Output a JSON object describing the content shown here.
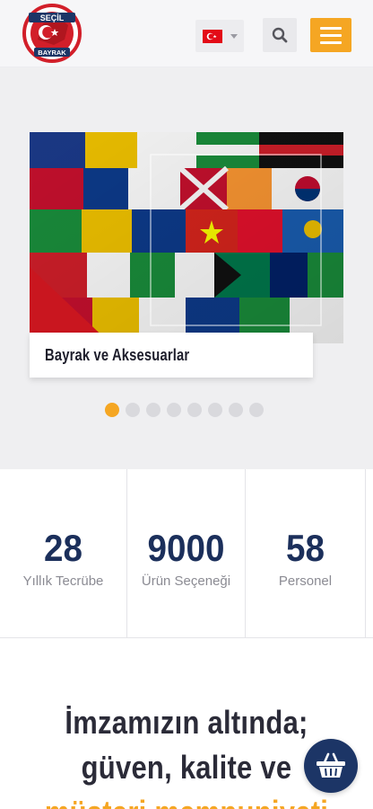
{
  "header": {
    "logo_text_top": "SEÇİL",
    "logo_text_bottom": "BAYRAK",
    "language": "tr",
    "icons": [
      "turkey-flag-icon",
      "caret-down-icon",
      "search-icon",
      "hamburger-menu-icon"
    ]
  },
  "slider": {
    "image": "world-flags-collage",
    "caption": "Bayrak ve Aksesuarlar",
    "dot_count": 8,
    "active_index": 0
  },
  "stats": [
    {
      "value": "28",
      "label": "Yıllık Tecrübe"
    },
    {
      "value": "9000",
      "label": "Ürün Seçeneği"
    },
    {
      "value": "58",
      "label": "Personel"
    }
  ],
  "tagline": {
    "line1": "İmzamızın altında;",
    "line2": "güven, kalite ve",
    "line3": "müşteri memnuniyeti"
  },
  "basket": {
    "icon": "shopping-basket-icon"
  },
  "colors": {
    "accent": "#f5a623",
    "navy": "#1b2f5b",
    "brand_red": "#d21f2a"
  }
}
